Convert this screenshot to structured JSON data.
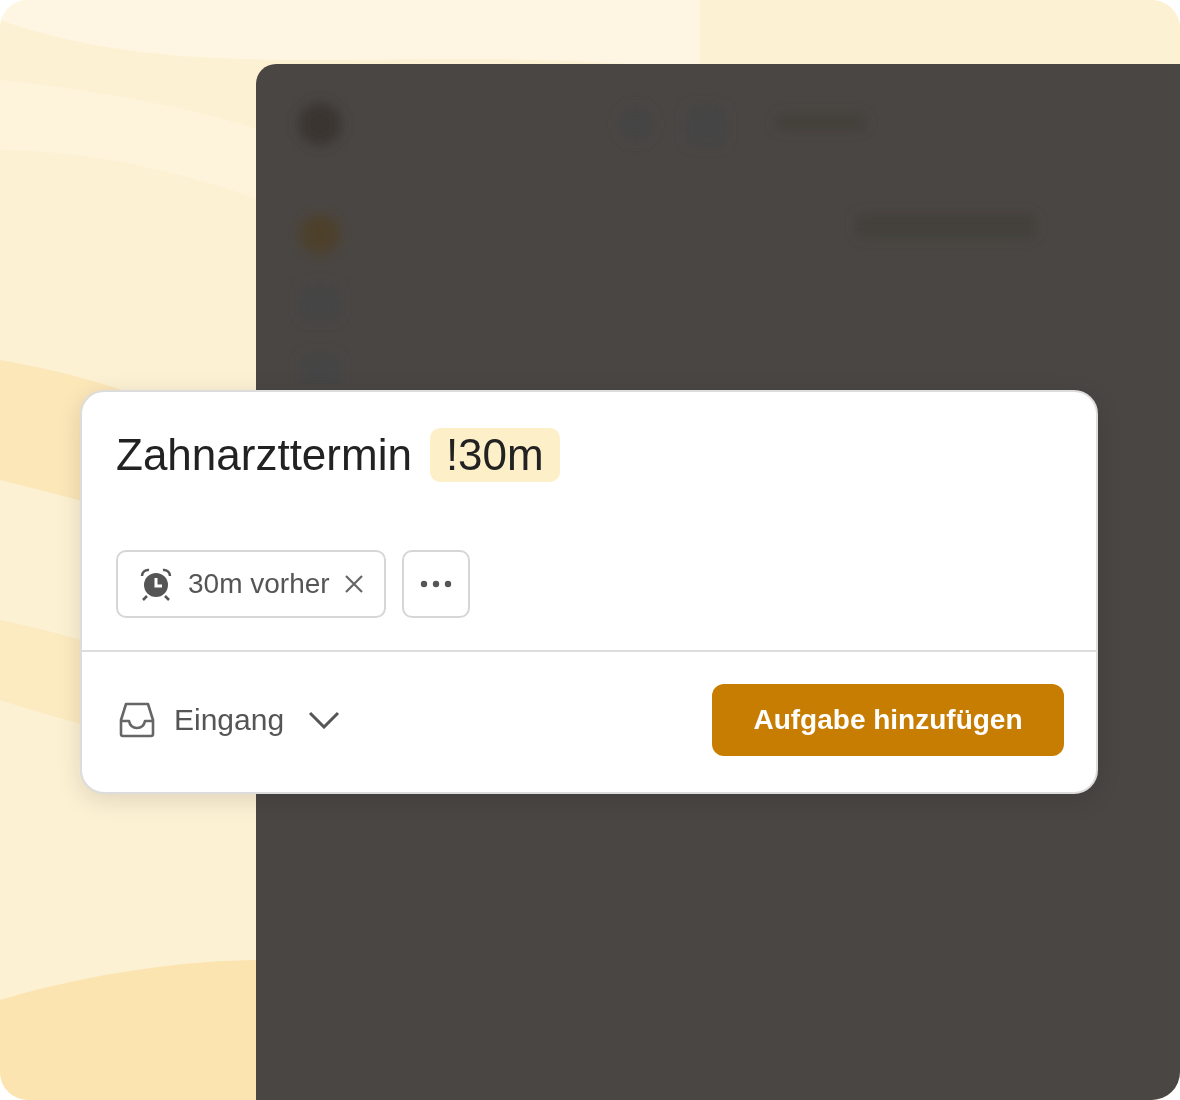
{
  "task": {
    "title": "Zahnarzttermin",
    "tag": "!30m"
  },
  "chips": [
    {
      "kind": "reminder",
      "label": "30m vorher",
      "removable": true
    },
    {
      "kind": "more"
    }
  ],
  "project": {
    "label": "Eingang"
  },
  "submit_button": {
    "label": "Aufgabe hinzufügen"
  }
}
